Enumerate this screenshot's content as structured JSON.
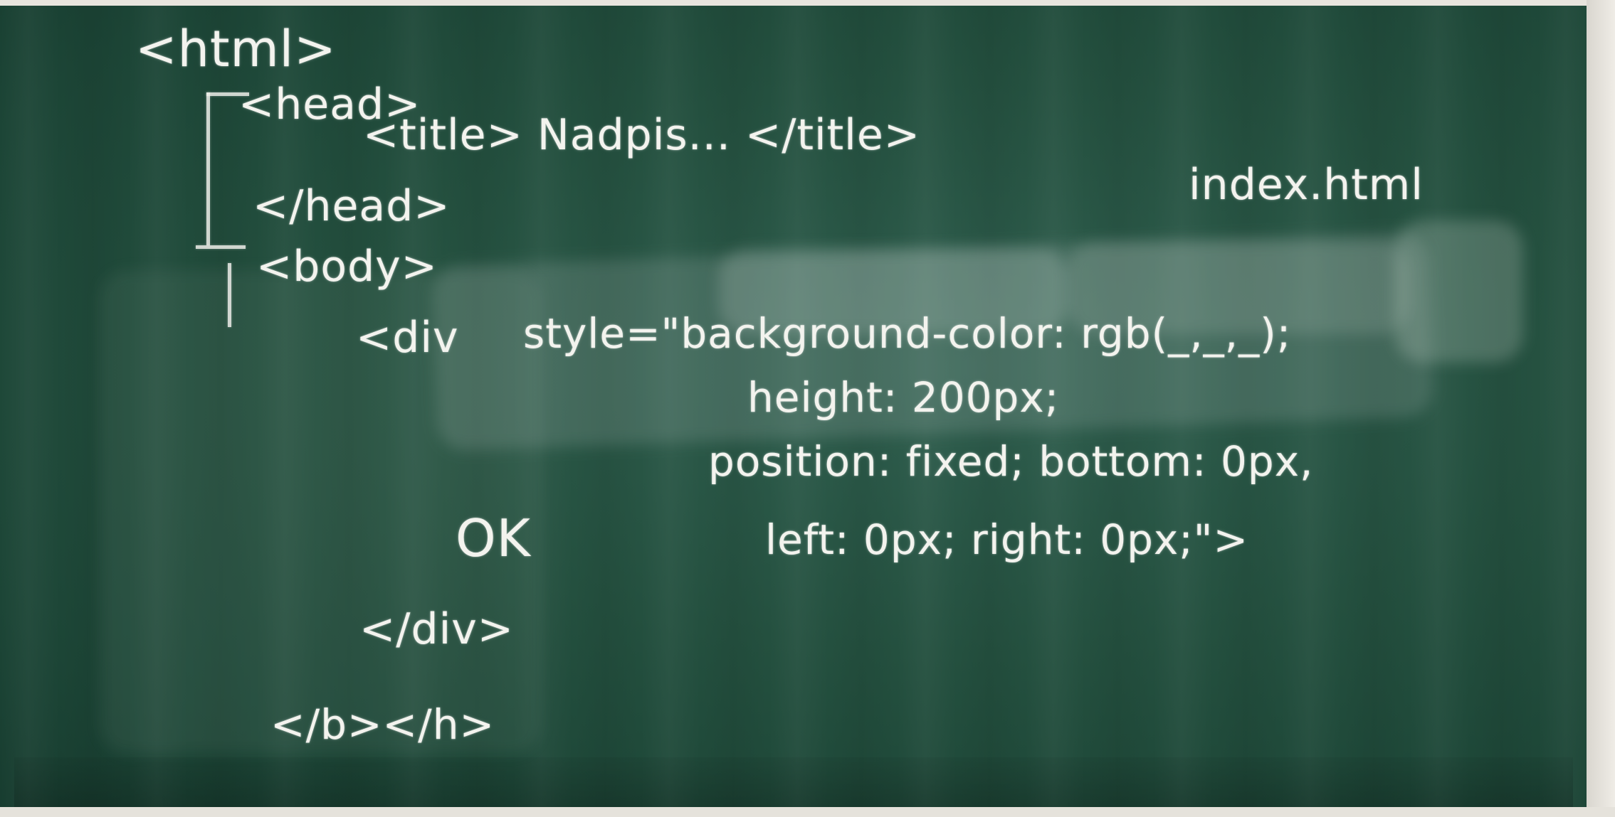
{
  "board": {
    "lines": {
      "html_open": "<html>",
      "head_open": "<head>",
      "title": "<title> Nadpis... </title>",
      "head_close": "</head>",
      "body_open": "<body>",
      "div_open": "<div",
      "style": "style=\"background-color: rgb(_,_,_);",
      "height": "height: 200px;",
      "position": "position: fixed; bottom: 0px,",
      "left_right": "left: 0px; right: 0px;\">",
      "content": "OK",
      "div_close": "</div>",
      "body_html_close": "</b></h>"
    },
    "file_label": "index.html"
  },
  "colors": {
    "board": "#24503f",
    "chalk": "#f3f3ee",
    "frame": "#e8e5de"
  }
}
